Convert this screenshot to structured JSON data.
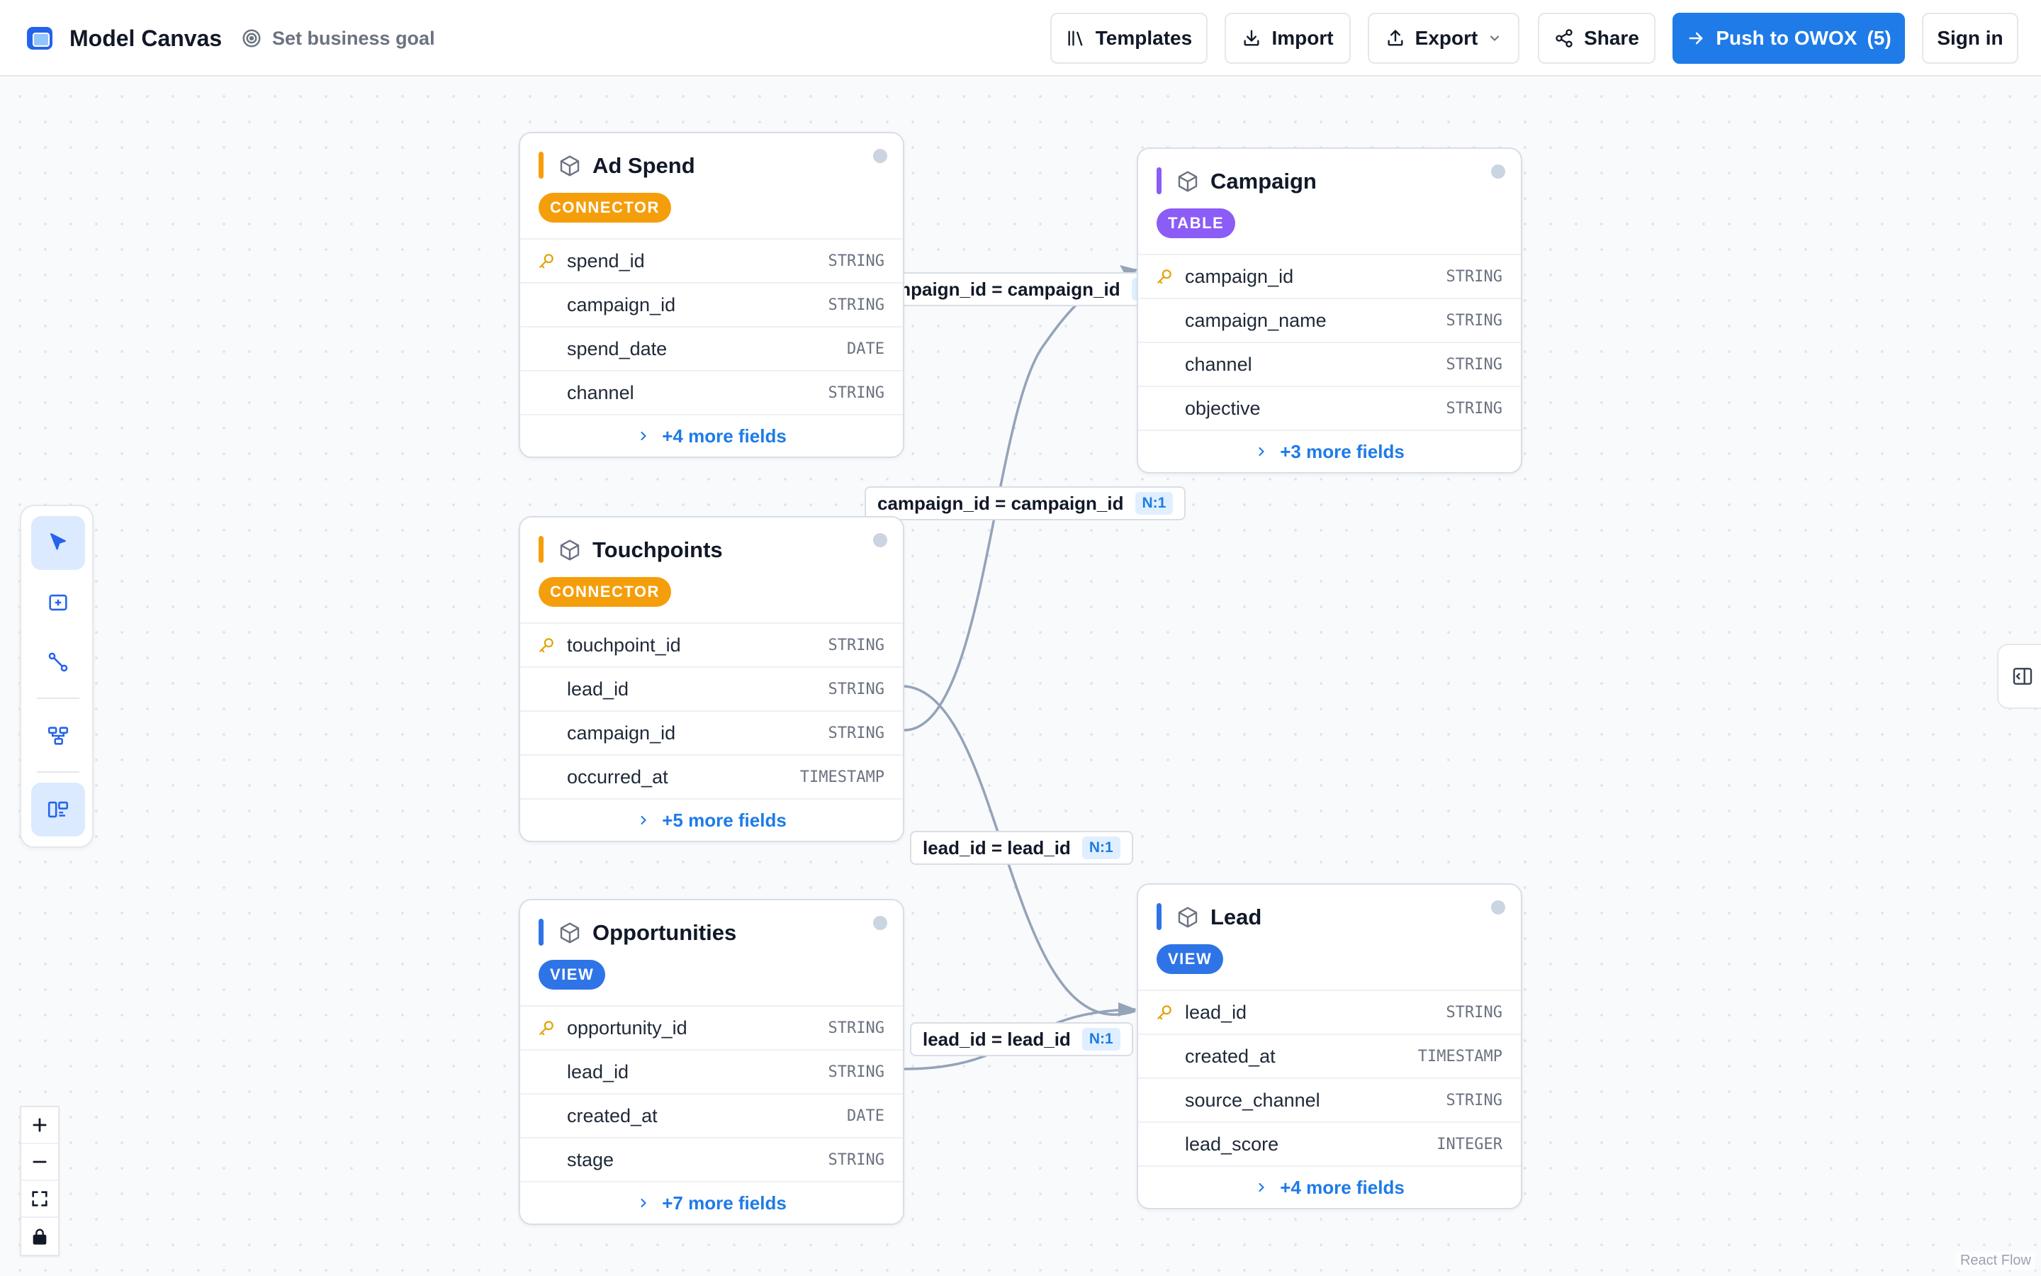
{
  "header": {
    "app_title": "Model Canvas",
    "goal_label": "Set business goal",
    "templates_label": "Templates",
    "import_label": "Import",
    "export_label": "Export",
    "share_label": "Share",
    "push_label": "Push to OWOX",
    "push_count": "(5)",
    "signin_label": "Sign in"
  },
  "nodes": {
    "ad_spend": {
      "title": "Ad Spend",
      "badge": "CONNECTOR",
      "accent": "#f59e0b",
      "fields": [
        {
          "name": "spend_id",
          "type": "STRING",
          "key": true
        },
        {
          "name": "campaign_id",
          "type": "STRING"
        },
        {
          "name": "spend_date",
          "type": "DATE"
        },
        {
          "name": "channel",
          "type": "STRING"
        }
      ],
      "more": "+4 more fields"
    },
    "campaign": {
      "title": "Campaign",
      "badge": "TABLE",
      "accent": "#8b5cf6",
      "fields": [
        {
          "name": "campaign_id",
          "type": "STRING",
          "key": true
        },
        {
          "name": "campaign_name",
          "type": "STRING"
        },
        {
          "name": "channel",
          "type": "STRING"
        },
        {
          "name": "objective",
          "type": "STRING"
        }
      ],
      "more": "+3 more fields"
    },
    "touchpoints": {
      "title": "Touchpoints",
      "badge": "CONNECTOR",
      "accent": "#f59e0b",
      "fields": [
        {
          "name": "touchpoint_id",
          "type": "STRING",
          "key": true
        },
        {
          "name": "lead_id",
          "type": "STRING"
        },
        {
          "name": "campaign_id",
          "type": "STRING"
        },
        {
          "name": "occurred_at",
          "type": "TIMESTAMP"
        }
      ],
      "more": "+5 more fields"
    },
    "opportunities": {
      "title": "Opportunities",
      "badge": "VIEW",
      "accent": "#2f74e6",
      "fields": [
        {
          "name": "opportunity_id",
          "type": "STRING",
          "key": true
        },
        {
          "name": "lead_id",
          "type": "STRING"
        },
        {
          "name": "created_at",
          "type": "DATE"
        },
        {
          "name": "stage",
          "type": "STRING"
        }
      ],
      "more": "+7 more fields"
    },
    "lead": {
      "title": "Lead",
      "badge": "VIEW",
      "accent": "#2f74e6",
      "fields": [
        {
          "name": "lead_id",
          "type": "STRING",
          "key": true
        },
        {
          "name": "created_at",
          "type": "TIMESTAMP"
        },
        {
          "name": "source_channel",
          "type": "STRING"
        },
        {
          "name": "lead_score",
          "type": "INTEGER"
        }
      ],
      "more": "+4 more fields"
    }
  },
  "edges": [
    {
      "label": "mpaign_id = campaign_id",
      "cardinality": "N"
    },
    {
      "label": "campaign_id = campaign_id",
      "cardinality": "N:1"
    },
    {
      "label": "lead_id = lead_id",
      "cardinality": "N:1"
    },
    {
      "label": "lead_id = lead_id",
      "cardinality": "N:1"
    }
  ],
  "attribution": "React Flow"
}
